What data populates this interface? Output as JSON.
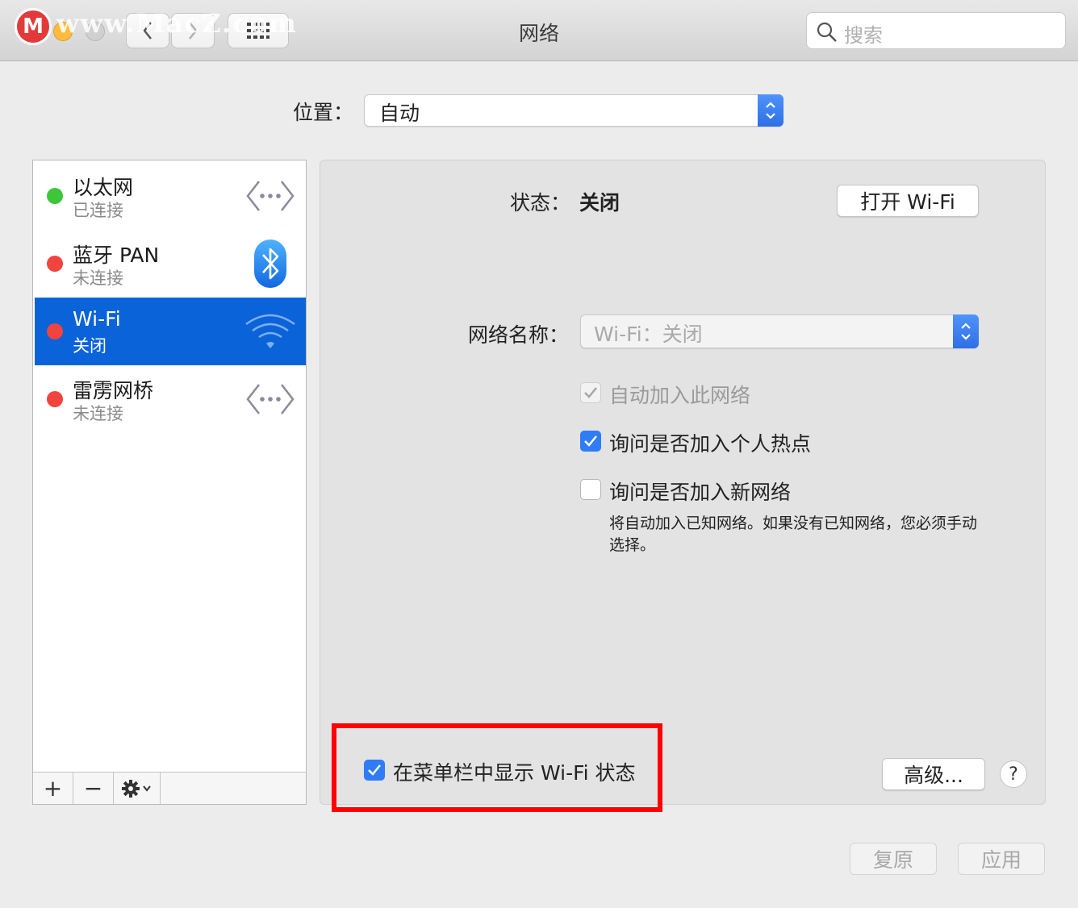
{
  "window": {
    "title": "网络",
    "watermark": "www.MacZ.com",
    "watermark_logo": "M",
    "search_placeholder": "搜索"
  },
  "location": {
    "label": "位置：",
    "value": "自动"
  },
  "services": [
    {
      "name": "以太网",
      "status": "已连接",
      "dot_color": "#3ec63b",
      "icon": "ethernet-icon",
      "selected": false
    },
    {
      "name": "蓝牙 PAN",
      "status": "未连接",
      "dot_color": "#f2443f",
      "icon": "bluetooth-icon",
      "selected": false
    },
    {
      "name": "Wi-Fi",
      "status": "关闭",
      "dot_color": "#f2443f",
      "icon": "wifi-icon",
      "selected": true
    },
    {
      "name": "雷雳网桥",
      "status": "未连接",
      "dot_color": "#f2443f",
      "icon": "thunderbolt-bridge-icon",
      "selected": false
    }
  ],
  "sidebar_toolbar": {
    "add": "+",
    "remove": "−"
  },
  "detail": {
    "status_label": "状态：",
    "status_value": "关闭",
    "toggle_wifi_button": "打开 Wi-Fi",
    "network_name_label": "网络名称：",
    "network_name_value": "Wi-Fi：关闭",
    "auto_join_label": "自动加入此网络",
    "ask_hotspot_label": "询问是否加入个人热点",
    "ask_new_label": "询问是否加入新网络",
    "ask_new_help": "将自动加入已知网络。如果没有已知网络，您必须手动选择。",
    "show_status_label": "在菜单栏中显示 Wi-Fi 状态",
    "advanced_button": "高级...",
    "help_button": "?"
  },
  "checkboxes": {
    "auto_join": true,
    "ask_hotspot": true,
    "ask_new": false,
    "show_status": true
  },
  "footer": {
    "revert_button": "复原",
    "apply_button": "应用"
  },
  "colors": {
    "selection": "#0b63d9",
    "accent": "#2f7cf6",
    "highlight_box": "#ff0000"
  }
}
